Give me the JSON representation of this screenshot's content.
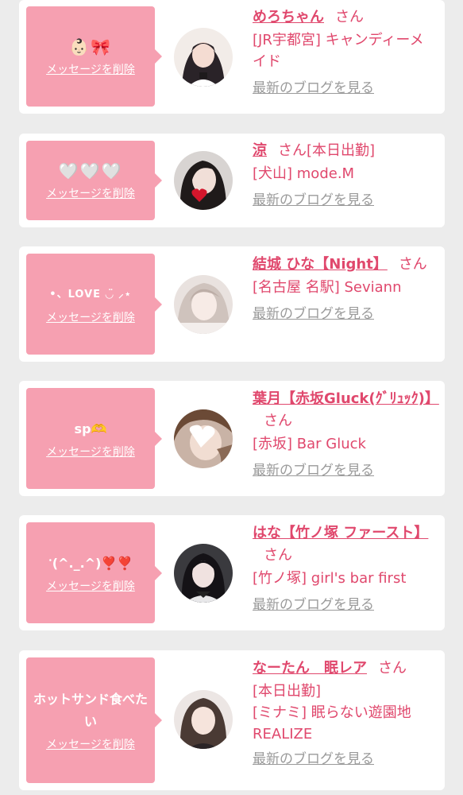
{
  "colors": {
    "background": "#ececec",
    "card": "#ffffff",
    "bubble": "#f6a0b1",
    "accent": "#e0486d",
    "muted": "#9a9a9a"
  },
  "labels": {
    "delete": "メッセージを削除",
    "san": "さん",
    "blog": "最新のブログを見る"
  },
  "entries": [
    {
      "message": "👶🏻🎀",
      "name": "めろちゃん",
      "suffix": "",
      "meta": [
        "[JR宇都宮] キャンディーメイド"
      ]
    },
    {
      "message": "🤍🤍🤍",
      "name": "涼",
      "suffix": "[本日出勤]",
      "meta": [
        "[犬山] mode.M"
      ]
    },
    {
      "message": "•、LOVE ◡̈ ⸝⋆",
      "name": "結城 ひな【Night】",
      "suffix": "",
      "meta": [
        "[名古屋 名駅] Seviann"
      ]
    },
    {
      "message": "sp🫶",
      "name": "葉月【赤坂Gluck(ｸﾞﾘｭｯｸ)】",
      "suffix": "",
      "meta": [
        "[赤坂] Bar Gluck"
      ]
    },
    {
      "message": "ॱ(^._.^)❣️❣️",
      "name": "はな【竹ノ塚 ファースト】",
      "suffix": "",
      "meta": [
        "[竹ノ塚] girl's bar first"
      ]
    },
    {
      "message": "ホットサンド食べたい",
      "name": "なーたん　眠レア",
      "suffix": "",
      "meta": [
        "[本日出勤]",
        "[ミナミ] 眠らない遊園地REALIZE"
      ]
    }
  ]
}
